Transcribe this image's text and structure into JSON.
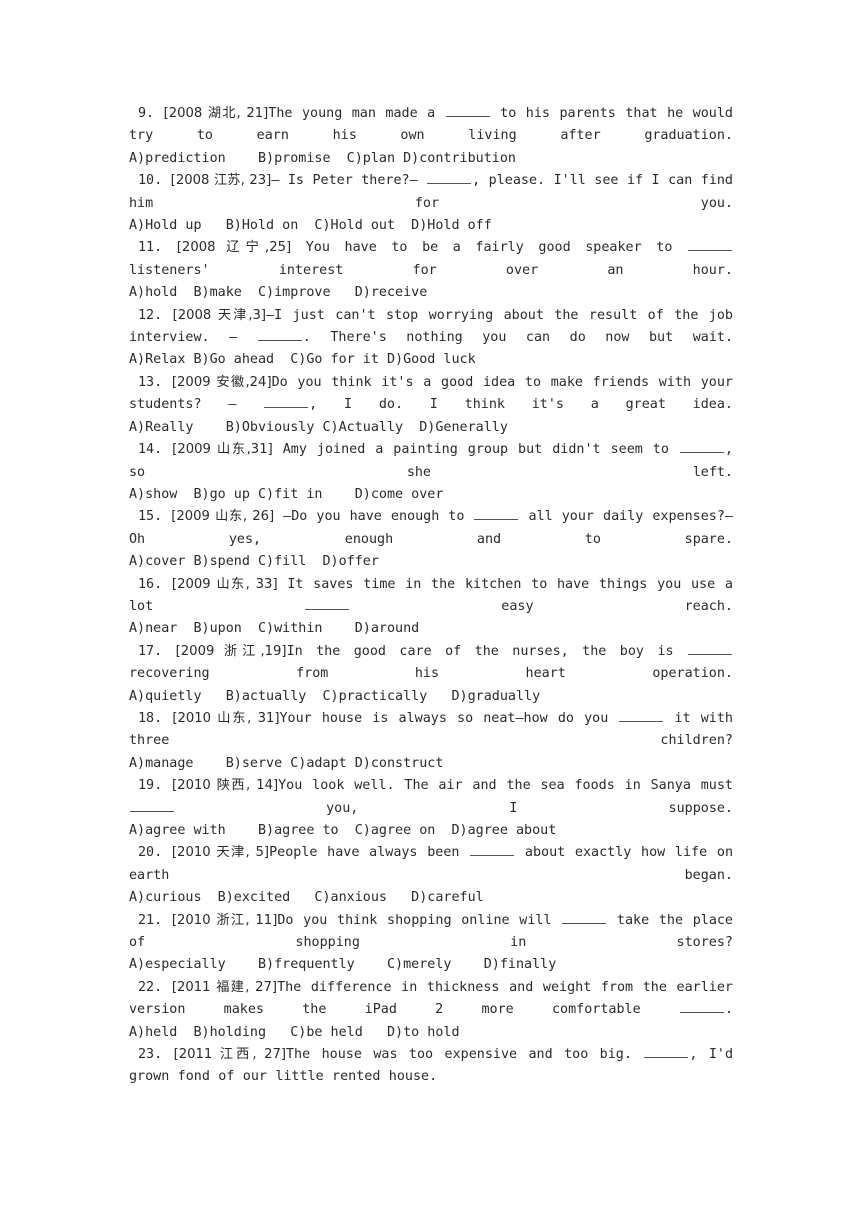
{
  "document": {
    "type": "english-grammar-multiple-choice-worksheet",
    "page_background": "#ffffff",
    "text_color": "#2b2b2b",
    "blank_mark": "_____"
  },
  "questions": [
    {
      "number": "9.",
      "source": "[2008 湖北, 21]",
      "stem_before": "The young man made a ",
      "stem_after": " to his parents that he would try to earn his own living after graduation.",
      "options": "A)prediction    B)promise  C)plan D)contribution"
    },
    {
      "number": "10.",
      "source": "[2008 江苏, 23]",
      "stem_before": "— Is Peter there?— ",
      "stem_after": ", please. I'll see if I can find him for you.",
      "options": "A)Hold up   B)Hold on  C)Hold out  D)Hold off"
    },
    {
      "number": "11.",
      "source": "[2008 辽宁,25]",
      "stem_before": " You have to be a fairly good speaker to ",
      "stem_after": " listeners' interest for over an hour.",
      "options": "A)hold  B)make  C)improve   D)receive"
    },
    {
      "number": "12.",
      "source": "[2008 天津,3]",
      "stem_before": "—I just can't stop worrying about the result of the job interview.\n— ",
      "stem_after": ". There's nothing you can do now but wait.",
      "options": "A)Relax B)Go ahead  C)Go for it D)Good luck"
    },
    {
      "number": "13.",
      "source": "[2009 安徽,24]",
      "stem_before": "Do you think it's a good idea to make friends with your students?\n— ",
      "stem_after": ", I do. I think it's a great idea.",
      "options": "A)Really    B)Obviously C)Actually  D)Generally"
    },
    {
      "number": "14.",
      "source": "[2009 山东,31]",
      "stem_before": " Amy joined a painting group but didn't seem to ",
      "stem_after": ", so she left.",
      "options": "A)show  B)go up C)fit in    D)come over"
    },
    {
      "number": "15.",
      "source": "[2009 山东, 26]",
      "stem_before": " —Do you have enough to ",
      "stem_after": " all your daily expenses?—Oh yes, enough and to spare.",
      "options": "A)cover B)spend C)fill  D)offer"
    },
    {
      "number": "16.",
      "source": "[2009 山东, 33]",
      "stem_before": " It saves time in the kitchen to have things you use a lot ",
      "stem_after": " easy reach.",
      "options": "A)near  B)upon  C)within    D)around"
    },
    {
      "number": "17.",
      "source": "[2009 浙江,19]",
      "stem_before": "In the good care of the nurses, the boy is ",
      "stem_after": " recovering from his heart operation.",
      "options": "A)quietly   B)actually  C)practically   D)gradually"
    },
    {
      "number": "18.",
      "source": "[2010 山东, 31]",
      "stem_before": "Your house is always so neat—how do you ",
      "stem_after": " it with three children?",
      "options": "A)manage    B)serve C)adapt D)construct"
    },
    {
      "number": "19.",
      "source": "[2010 陕西, 14]",
      "stem_before": "You look well. The air and the sea foods in Sanya must ",
      "stem_after": " you, I suppose.",
      "options": "A)agree with    B)agree to  C)agree on  D)agree about"
    },
    {
      "number": "20.",
      "source": "[2010 天津, 5]",
      "stem_before": "People have always been ",
      "stem_after": " about exactly how life on earth began.",
      "options": "A)curious  B)excited   C)anxious   D)careful"
    },
    {
      "number": "21.",
      "source": "[2010 浙江, 11]",
      "stem_before": "Do you think shopping online will ",
      "stem_after": " take the place of shopping in stores?",
      "options": "A)especially    B)frequently    C)merely    D)finally"
    },
    {
      "number": "22.",
      "source": "[2011 福建, 27]",
      "stem_before": "The difference in thickness and weight from the earlier version makes the iPad 2 more comfortable ",
      "stem_after": ".",
      "options": "A)held  B)holding   C)be held   D)to hold"
    },
    {
      "number": "23.",
      "source": "[2011 江西, 27]",
      "stem_before": "The house was too expensive and too big. ",
      "stem_after": ", I'd grown fond of our little rented house.",
      "options": ""
    }
  ]
}
